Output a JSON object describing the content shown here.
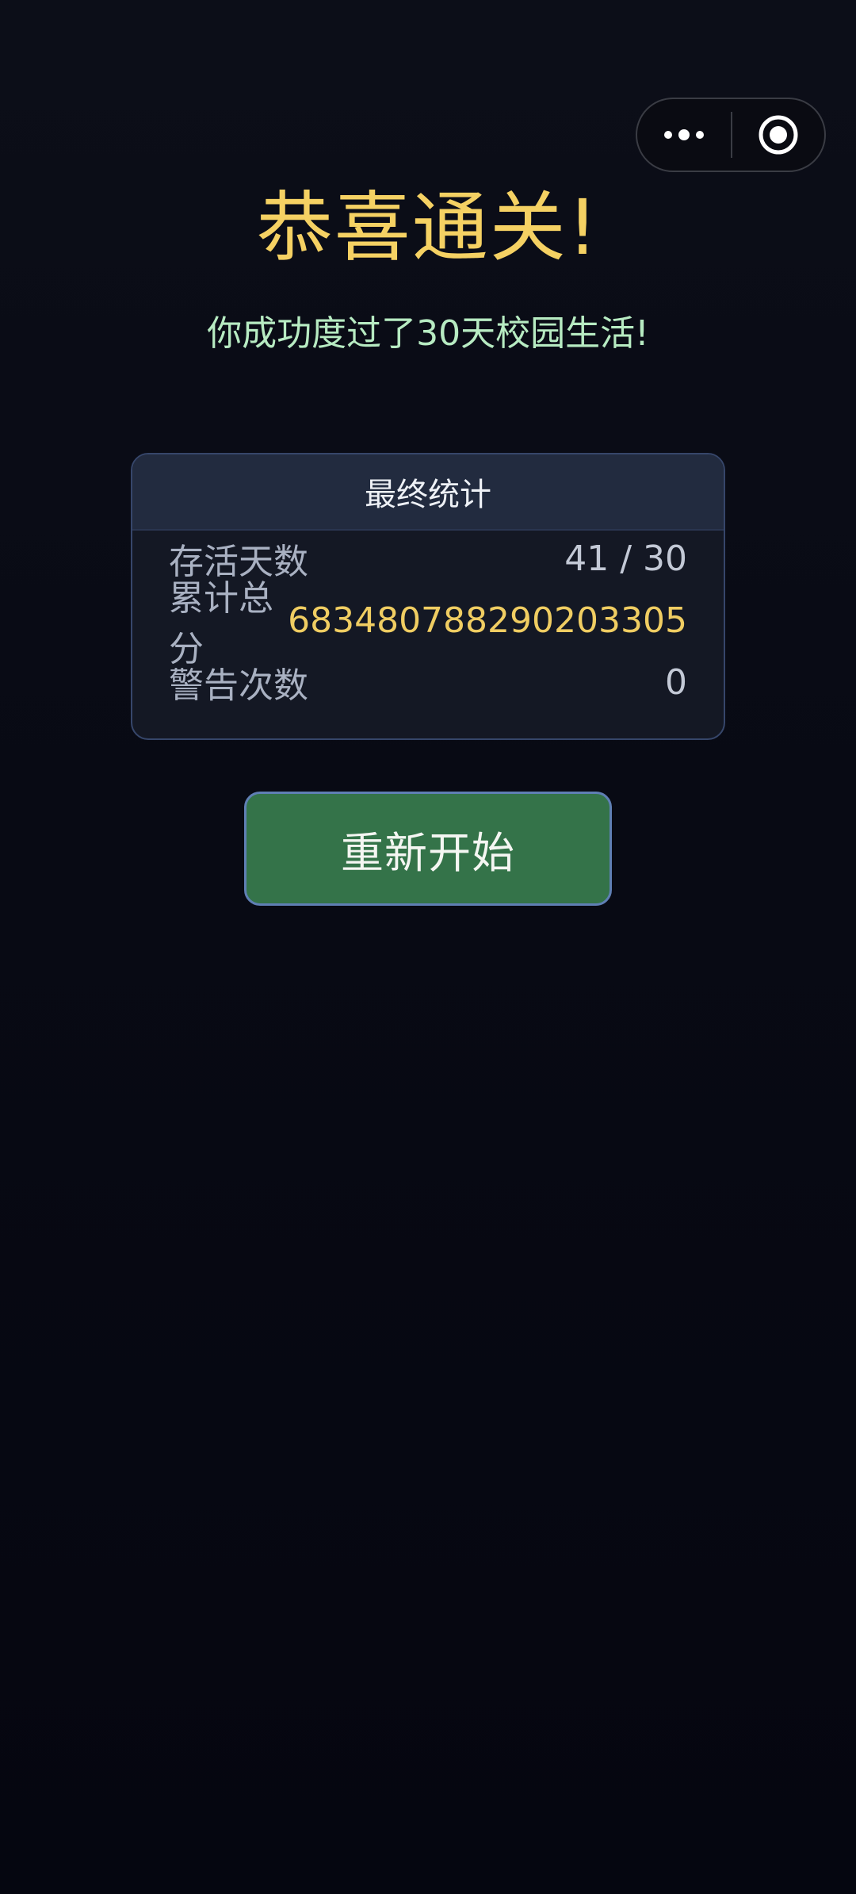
{
  "capsule": {
    "more_icon": "more-dots-icon",
    "close_icon": "target-circle-icon"
  },
  "header": {
    "title": "恭喜通关!",
    "subtitle": "你成功度过了30天校园生活!"
  },
  "stats": {
    "heading": "最终统计",
    "rows": [
      {
        "label": "存活天数",
        "value": "41 / 30"
      },
      {
        "label": "累计总分",
        "value": "683480788290203305"
      },
      {
        "label": "警告次数",
        "value": "0"
      }
    ]
  },
  "actions": {
    "restart_label": "重新开始"
  },
  "colors": {
    "title": "#f5d163",
    "subtitle": "#b7ebc2",
    "score": "#f0cd62",
    "button": "#347349",
    "button_border": "#5f7fb4",
    "background": "#080a14"
  }
}
